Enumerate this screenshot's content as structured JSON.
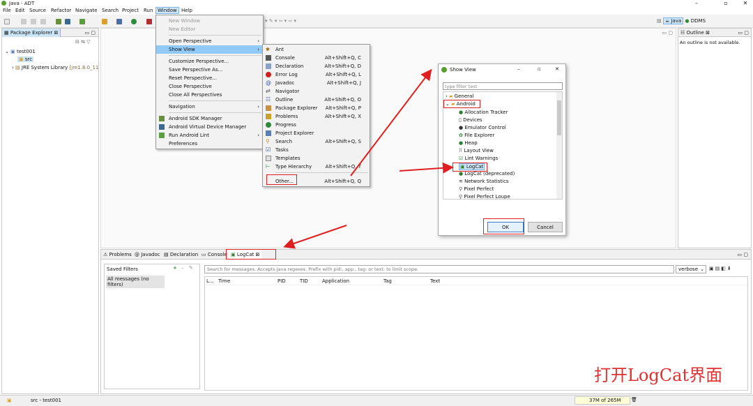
{
  "window": {
    "title": "Java - ADT"
  },
  "menubar": {
    "items": [
      "File",
      "Edit",
      "Source",
      "Refactor",
      "Navigate",
      "Search",
      "Project",
      "Run",
      "Window",
      "Help"
    ]
  },
  "perspectives": {
    "java": "Java",
    "ddms": "DDMS"
  },
  "package_explorer": {
    "tab": "Package Explorer",
    "project": "test001",
    "src": "src",
    "jre": "JRE System Library",
    "jre_suffix": "[jre1.8.0_11"
  },
  "outline": {
    "tab": "Outline",
    "message": "An outline is not available."
  },
  "window_menu": {
    "items": [
      "New Window",
      "New Editor",
      "Open Perspective",
      "Show View",
      "Customize Perspective...",
      "Save Perspective As...",
      "Reset Perspective...",
      "Close Perspective",
      "Close All Perspectives",
      "Navigation",
      "Android SDK Manager",
      "Android Virtual Device Manager",
      "Run Android Lint",
      "Preferences"
    ]
  },
  "show_view_menu": {
    "items": [
      {
        "label": "Ant",
        "shortcut": ""
      },
      {
        "label": "Console",
        "shortcut": "Alt+Shift+Q, C"
      },
      {
        "label": "Declaration",
        "shortcut": "Alt+Shift+Q, D"
      },
      {
        "label": "Error Log",
        "shortcut": "Alt+Shift+Q, L"
      },
      {
        "label": "Javadoc",
        "shortcut": "Alt+Shift+Q, J"
      },
      {
        "label": "Navigator",
        "shortcut": ""
      },
      {
        "label": "Outline",
        "shortcut": "Alt+Shift+Q, O"
      },
      {
        "label": "Package Explorer",
        "shortcut": "Alt+Shift+Q, P"
      },
      {
        "label": "Problems",
        "shortcut": "Alt+Shift+Q, X"
      },
      {
        "label": "Progress",
        "shortcut": ""
      },
      {
        "label": "Project Explorer",
        "shortcut": ""
      },
      {
        "label": "Search",
        "shortcut": "Alt+Shift+Q, S"
      },
      {
        "label": "Tasks",
        "shortcut": ""
      },
      {
        "label": "Templates",
        "shortcut": ""
      },
      {
        "label": "Type Hierarchy",
        "shortcut": "Alt+Shift+Q, T"
      },
      {
        "label": "Other...",
        "shortcut": "Alt+Shift+Q, Q"
      }
    ]
  },
  "show_view_dialog": {
    "title": "Show View",
    "filter_placeholder": "type filter text",
    "general": "General",
    "android": "Android",
    "children": [
      "Allocation Tracker",
      "Devices",
      "Emulator Control",
      "File Explorer",
      "Heap",
      "Layout View",
      "Lint Warnings",
      "LogCat",
      "LogCat (deprecated)",
      "Network Statistics",
      "Pixel Perfect",
      "Pixel Perfect Loupe"
    ],
    "ok": "OK",
    "cancel": "Cancel"
  },
  "bottom_tabs": [
    "Problems",
    "Javadoc",
    "Declaration",
    "Console",
    "LogCat"
  ],
  "logcat": {
    "saved_filters": "Saved Filters",
    "all_messages": "All messages (no filters)",
    "search_placeholder": "Search for messages. Accepts Java regexes. Prefix with pid:, app:, tag: or text: to limit scope.",
    "level": "verbose",
    "columns": [
      "L...",
      "Time",
      "PID",
      "TID",
      "Application",
      "Tag",
      "Text"
    ]
  },
  "status": {
    "path": "src - test001",
    "memory": "37M of 265M"
  },
  "watermark": "打开LogCat界面",
  "colors": {
    "highlight": "#91c9f7",
    "annotation": "#e02020",
    "selection": "#cde6f7"
  }
}
